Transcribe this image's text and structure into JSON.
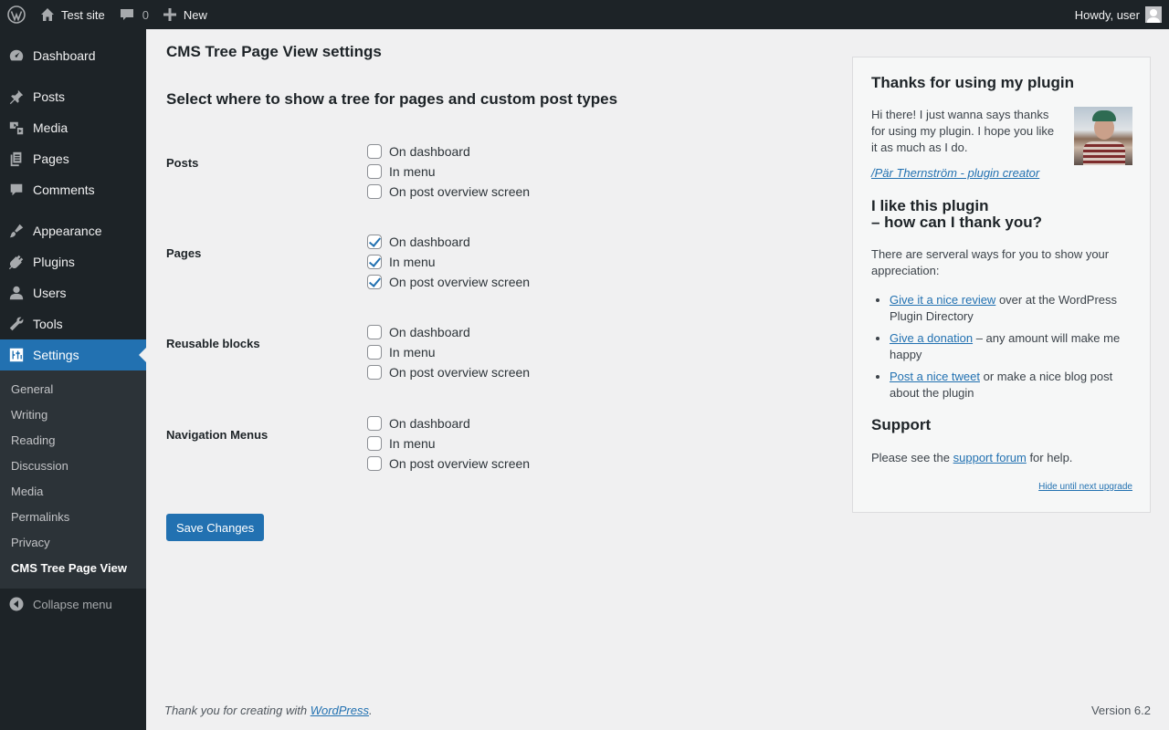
{
  "adminbar": {
    "site_name": "Test site",
    "comments_count": "0",
    "new_label": "New",
    "greeting": "Howdy, user"
  },
  "sidebar": {
    "items": [
      {
        "label": "Dashboard",
        "icon": "dashboard-icon"
      },
      {
        "label": "Posts",
        "icon": "pin-icon"
      },
      {
        "label": "Media",
        "icon": "media-icon"
      },
      {
        "label": "Pages",
        "icon": "pages-icon"
      },
      {
        "label": "Comments",
        "icon": "comment-icon"
      },
      {
        "label": "Appearance",
        "icon": "brush-icon"
      },
      {
        "label": "Plugins",
        "icon": "plug-icon"
      },
      {
        "label": "Users",
        "icon": "user-icon"
      },
      {
        "label": "Tools",
        "icon": "wrench-icon"
      },
      {
        "label": "Settings",
        "icon": "sliders-icon"
      }
    ],
    "submenu": [
      "General",
      "Writing",
      "Reading",
      "Discussion",
      "Media",
      "Permalinks",
      "Privacy",
      "CMS Tree Page View"
    ],
    "collapse_label": "Collapse menu"
  },
  "main": {
    "page_title": "CMS Tree Page View settings",
    "section_title": "Select where to show a tree for pages and custom post types",
    "options": [
      "On dashboard",
      "In menu",
      "On post overview screen"
    ],
    "rows": [
      {
        "label": "Posts",
        "checked": [
          false,
          false,
          false
        ]
      },
      {
        "label": "Pages",
        "checked": [
          true,
          true,
          true
        ]
      },
      {
        "label": "Reusable blocks",
        "checked": [
          false,
          false,
          false
        ]
      },
      {
        "label": "Navigation Menus",
        "checked": [
          false,
          false,
          false
        ]
      }
    ],
    "save_label": "Save Changes"
  },
  "box": {
    "title": "Thanks for using my plugin",
    "intro": "Hi there! I just wanna says thanks for using my plugin. I hope you like it as much as I do.",
    "signature": "/Pär Thernström - plugin creator",
    "like_line1": "I like this plugin",
    "like_line2": "– how can I thank you?",
    "ways_text": "There are serveral ways for you to show your appreciation:",
    "ways": [
      {
        "link": "Give it a nice review",
        "rest": " over at the WordPress Plugin Directory"
      },
      {
        "link": "Give a donation",
        "rest": " – any amount will make me happy"
      },
      {
        "link": "Post a nice tweet",
        "rest": " or make a nice blog post about the plugin"
      }
    ],
    "support_title": "Support",
    "support_pre": "Please see the ",
    "support_link": "support forum",
    "support_post": " for help.",
    "hide_link": "Hide until next upgrade"
  },
  "footer": {
    "thanks_pre": "Thank you for creating with ",
    "thanks_link": "WordPress",
    "thanks_post": ".",
    "version": "Version 6.2"
  }
}
